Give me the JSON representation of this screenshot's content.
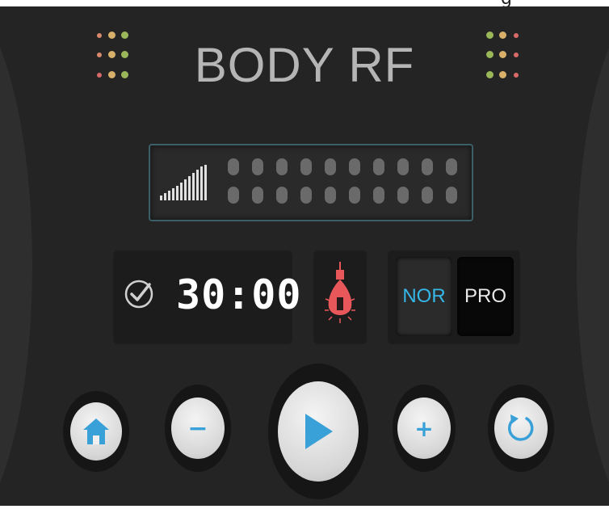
{
  "window": {
    "partial_header_text": "g"
  },
  "app": {
    "title": "BODY RF"
  },
  "level_indicator": {
    "icon": "signal-strength-icon",
    "columns": 10,
    "rows": 2
  },
  "timer": {
    "icon": "check-circle-icon",
    "value": "30:00"
  },
  "lamp": {
    "icon": "light-bulb-icon",
    "color": "#e8575a"
  },
  "mode": {
    "options": [
      "NOR",
      "PRO"
    ],
    "selected": "NOR",
    "active_color": "#35b8e8"
  },
  "controls": {
    "home": {
      "icon": "home-icon"
    },
    "minus": {
      "label": "−",
      "icon": "minus-icon"
    },
    "play": {
      "icon": "play-icon"
    },
    "plus": {
      "label": "+",
      "icon": "plus-icon"
    },
    "reset": {
      "icon": "refresh-icon"
    }
  },
  "colors": {
    "accent": "#3aa0d8",
    "dot_orange": "#d88a6a",
    "dot_green": "#9ab85a",
    "dot_red": "#d86a6a"
  }
}
